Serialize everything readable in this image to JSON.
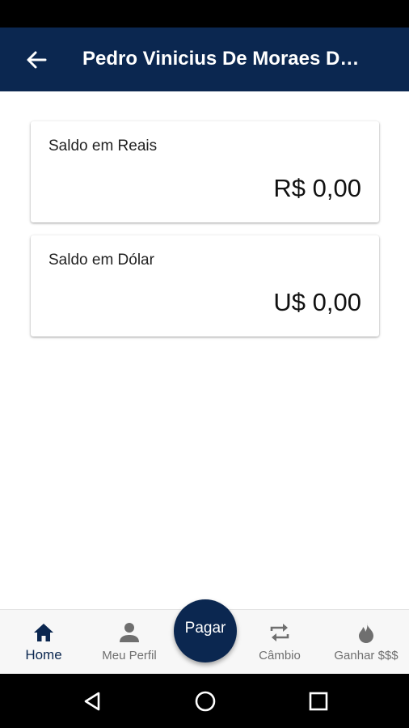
{
  "header": {
    "title": "Pedro Vinicius De Moraes D…",
    "back_icon": "arrow-left-icon"
  },
  "cards": [
    {
      "label": "Saldo em Reais",
      "value": "R$ 0,00"
    },
    {
      "label": "Saldo em Dólar",
      "value": "U$ 0,00"
    }
  ],
  "bottom_nav": {
    "items": [
      {
        "label": "Home",
        "icon": "home-icon",
        "active": true
      },
      {
        "label": "Meu Perfil",
        "icon": "person-icon",
        "active": false
      },
      {
        "label": "Câmbio",
        "icon": "swap-icon",
        "active": false
      },
      {
        "label": "Ganhar $$$",
        "icon": "flame-icon",
        "active": false
      }
    ],
    "center_button": "Pagar"
  },
  "system_nav": {
    "back": "triangle-back-icon",
    "home": "circle-home-icon",
    "recents": "square-recents-icon"
  },
  "colors": {
    "primary": "#0b2750",
    "inactive": "#6f6f6f",
    "background": "#ffffff"
  }
}
